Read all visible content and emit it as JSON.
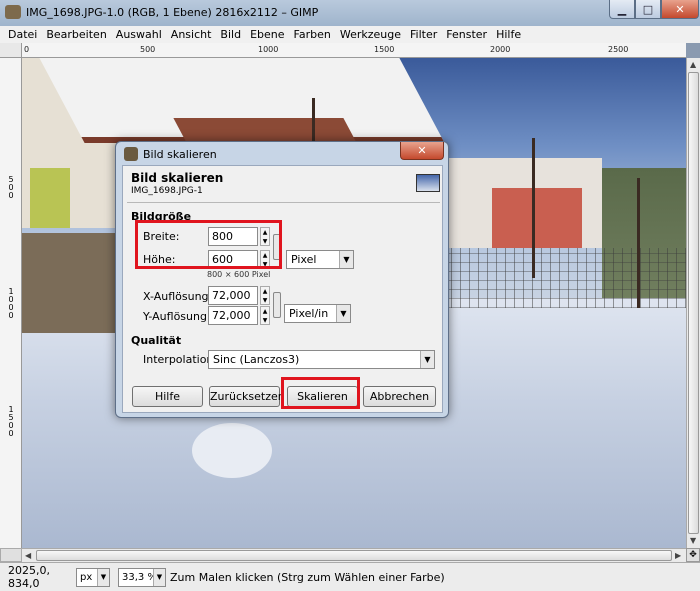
{
  "window": {
    "title": "IMG_1698.JPG-1.0 (RGB, 1 Ebene) 2816x2112 – GIMP",
    "min_label": "▁",
    "max_label": "□",
    "close_label": "✕"
  },
  "menu": [
    "Datei",
    "Bearbeiten",
    "Auswahl",
    "Ansicht",
    "Bild",
    "Ebene",
    "Farben",
    "Werkzeuge",
    "Filter",
    "Fenster",
    "Hilfe"
  ],
  "ruler": {
    "h_ticks": [
      "0",
      "500",
      "1000",
      "1500",
      "2000",
      "2500"
    ],
    "v_ticks": [
      "5",
      "0",
      "0",
      "1",
      "0",
      "0",
      "0",
      "1",
      "5",
      "0",
      "0"
    ]
  },
  "dialog": {
    "title": "Bild skalieren",
    "close_label": "✕",
    "header_title": "Bild skalieren",
    "header_subtitle": "IMG_1698.JPG-1",
    "section_size": "Bildgröße",
    "width_label": "Breite:",
    "width_value": "800",
    "height_label": "Höhe:",
    "height_value": "600",
    "size_note": "800 × 600 Pixel",
    "unit_select": "Pixel",
    "xres_label": "X-Auflösung:",
    "xres_value": "72,000",
    "yres_label": "Y-Auflösung:",
    "yres_value": "72,000",
    "res_unit_select": "Pixel/in",
    "section_quality": "Qualität",
    "interp_label": "Interpolation:",
    "interp_value": "Sinc (Lanczos3)",
    "btn_help": "Hilfe",
    "btn_reset": "Zurücksetzen",
    "btn_scale": "Skalieren",
    "btn_cancel": "Abbrechen"
  },
  "status": {
    "coords": "2025,0, 834,0",
    "unit": "px",
    "zoom": "33,3 %",
    "message": "Zum Malen klicken (Strg zum Wählen einer Farbe)"
  },
  "colors": {
    "highlight": "#e0141e",
    "titlebar": "#b9c9dc"
  }
}
